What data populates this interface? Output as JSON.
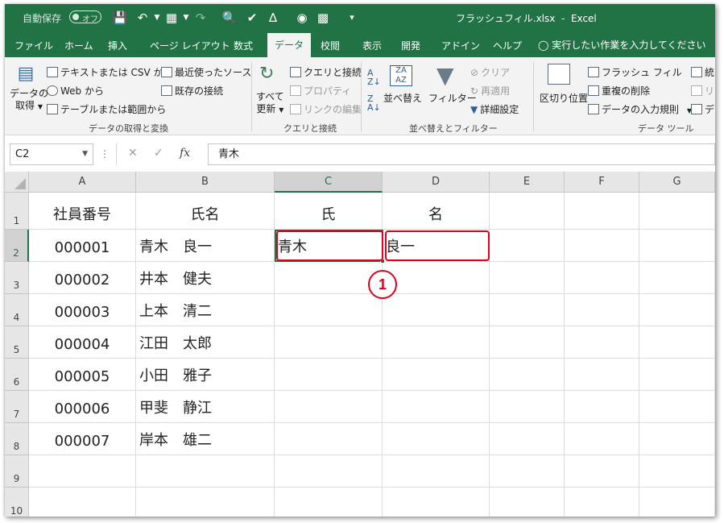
{
  "titlebar": {
    "autosave_label": "自動保存",
    "autosave_state": "オフ",
    "filename": "フラッシュフィル.xlsx",
    "app": "Excel"
  },
  "tabs": [
    "ファイル",
    "ホーム",
    "挿入",
    "ページ レイアウト",
    "数式",
    "データ",
    "校閲",
    "表示",
    "開発",
    "アドイン",
    "ヘルプ"
  ],
  "active_tab": "データ",
  "tellme": "実行したい作業を入力してください",
  "ribbon": {
    "get_data": {
      "big_button": [
        "データの",
        "取得"
      ],
      "from_text_csv": "テキストまたは CSV から",
      "from_web": "Web から",
      "from_table": "テーブルまたは範囲から",
      "recent_sources": "最近使ったソース",
      "existing_connections": "既存の接続",
      "group_label": "データの取得と変換"
    },
    "queries": {
      "refresh_all": [
        "すべて",
        "更新"
      ],
      "queries_connections": "クエリと接続",
      "properties": "プロパティ",
      "edit_links": "リンクの編集",
      "group_label": "クエリと接続"
    },
    "sort_filter": {
      "sort": "並べ替え",
      "filter": "フィルター",
      "clear": "クリア",
      "reapply": "再適用",
      "advanced": "詳細設定",
      "group_label": "並べ替えとフィルター"
    },
    "data_tools": {
      "text_to_columns": "区切り位置",
      "flash_fill": "フラッシュ フィル",
      "remove_duplicates": "重複の削除",
      "data_validation": "データの入力規則",
      "consolidate": "統",
      "relationships": "リ",
      "data_model": "デ",
      "group_label": "データ ツール"
    }
  },
  "formula_bar": {
    "name_box": "C2",
    "formula": "青木"
  },
  "columns": [
    "A",
    "B",
    "C",
    "D",
    "E",
    "F",
    "G"
  ],
  "rows": [
    {
      "num": "1",
      "cells": [
        "社員番号",
        "氏名",
        "氏",
        "名",
        "",
        "",
        ""
      ]
    },
    {
      "num": "2",
      "cells": [
        "000001",
        "青木　良一",
        "青木",
        "良一",
        "",
        "",
        ""
      ]
    },
    {
      "num": "3",
      "cells": [
        "000002",
        "井本　健夫",
        "",
        "",
        "",
        "",
        ""
      ]
    },
    {
      "num": "4",
      "cells": [
        "000003",
        "上本　清二",
        "",
        "",
        "",
        "",
        ""
      ]
    },
    {
      "num": "5",
      "cells": [
        "000004",
        "江田　太郎",
        "",
        "",
        "",
        "",
        ""
      ]
    },
    {
      "num": "6",
      "cells": [
        "000005",
        "小田　雅子",
        "",
        "",
        "",
        "",
        ""
      ]
    },
    {
      "num": "7",
      "cells": [
        "000006",
        "甲斐　静江",
        "",
        "",
        "",
        "",
        ""
      ]
    },
    {
      "num": "8",
      "cells": [
        "000007",
        "岸本　雄二",
        "",
        "",
        "",
        "",
        ""
      ]
    },
    {
      "num": "9",
      "cells": [
        "",
        "",
        "",
        "",
        "",
        "",
        ""
      ]
    },
    {
      "num": "10",
      "cells": [
        "",
        "",
        "",
        "",
        "",
        "",
        ""
      ]
    }
  ],
  "annotation": {
    "badge": "1",
    "color": "#e0001b"
  },
  "colors": {
    "excel_green": "#217346",
    "ribbon_bg": "#f3f3f3",
    "header_bg": "#e6e6e6"
  }
}
